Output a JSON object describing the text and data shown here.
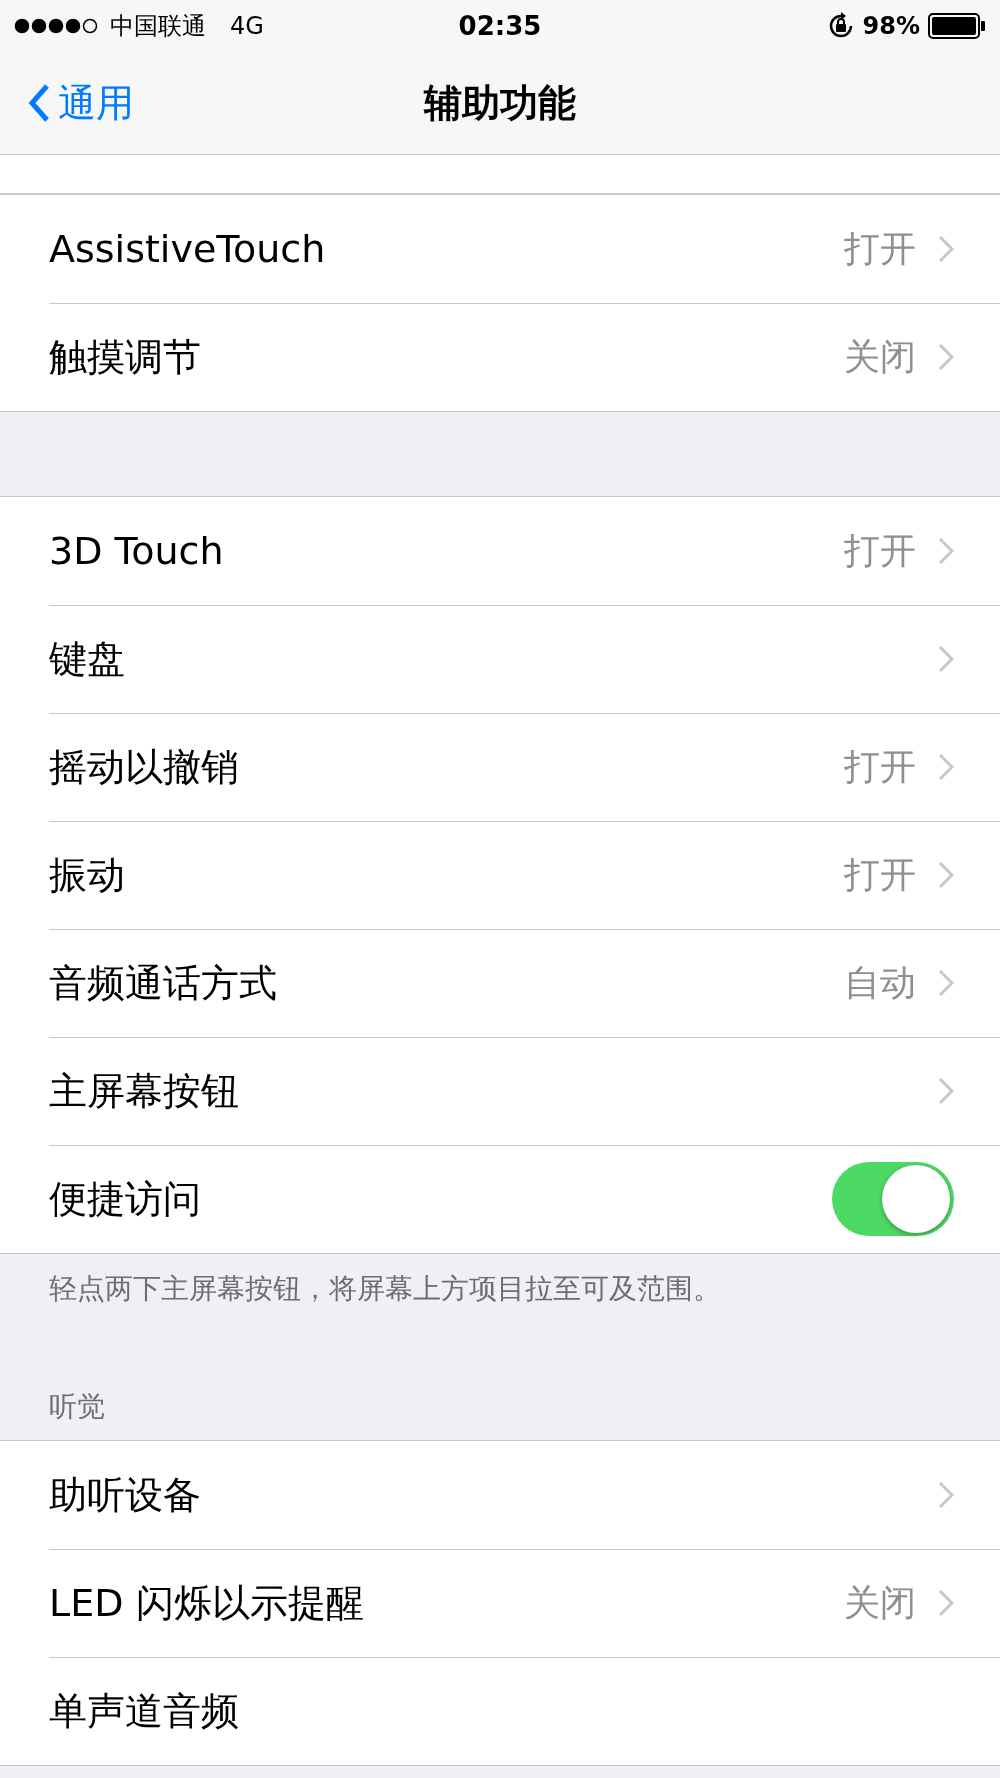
{
  "status_bar": {
    "carrier": "中国联通",
    "network": "4G",
    "time": "02:35",
    "battery": "98%"
  },
  "nav": {
    "back": "通用",
    "title": "辅助功能"
  },
  "groups": [
    {
      "rows": [
        {
          "kind": "link",
          "label": "AssistiveTouch",
          "value": "打开"
        },
        {
          "kind": "link",
          "label": "触摸调节",
          "value": "关闭"
        }
      ]
    },
    {
      "rows": [
        {
          "kind": "link",
          "label": "3D Touch",
          "value": "打开"
        },
        {
          "kind": "link",
          "label": "键盘"
        },
        {
          "kind": "link",
          "label": "摇动以撤销",
          "value": "打开"
        },
        {
          "kind": "link",
          "label": "振动",
          "value": "打开"
        },
        {
          "kind": "link",
          "label": "音频通话方式",
          "value": "自动"
        },
        {
          "kind": "link",
          "label": "主屏幕按钮"
        },
        {
          "kind": "toggle",
          "label": "便捷访问",
          "on": true
        }
      ],
      "footer": "轻点两下主屏幕按钮，将屏幕上方项目拉至可及范围。"
    },
    {
      "header": "听觉",
      "rows": [
        {
          "kind": "link",
          "label": "助听设备"
        },
        {
          "kind": "link",
          "label": "LED 闪烁以示提醒",
          "value": "关闭"
        },
        {
          "kind": "plain",
          "label": "单声道音频"
        }
      ]
    }
  ]
}
